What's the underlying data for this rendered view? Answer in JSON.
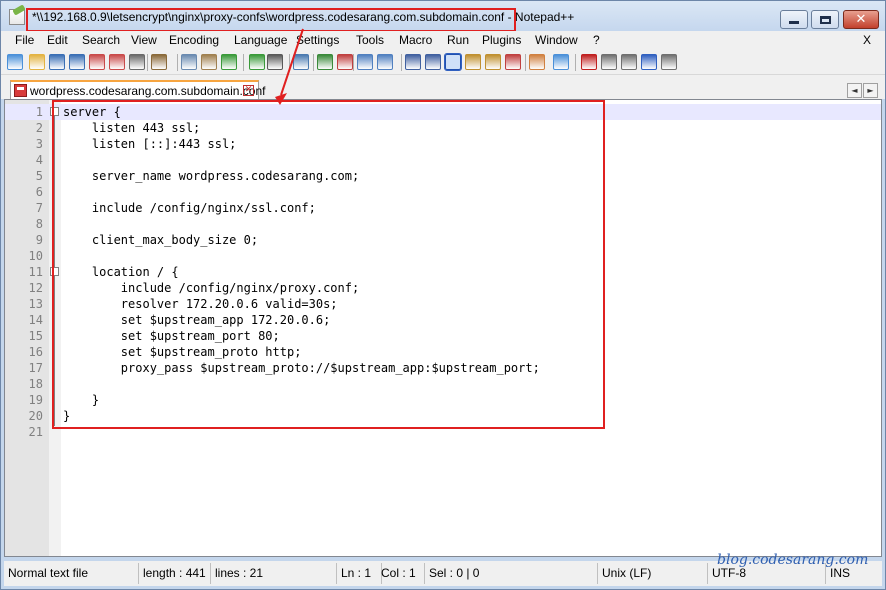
{
  "window": {
    "title": "*\\\\192.168.0.9\\letsencrypt\\nginx\\proxy-confs\\wordpress.codesarang.com.subdomain.conf - Notepad++",
    "minimize_label": "",
    "close_glyph": "✕"
  },
  "menu": {
    "items": [
      "File",
      "Edit",
      "Search",
      "View",
      "Encoding",
      "Language",
      "Settings",
      "Tools",
      "Macro",
      "Run",
      "Plugins",
      "Window",
      "?"
    ],
    "close_label": "X"
  },
  "toolbar": {
    "icons": [
      "new-file-icon",
      "open-file-icon",
      "save-icon",
      "save-all-icon",
      "close-icon",
      "close-all-icon",
      "print-icon",
      "cut-icon",
      "copy-icon",
      "paste-icon",
      "undo-icon",
      "redo-icon",
      "find-icon",
      "replace-icon",
      "zoom-in-icon",
      "zoom-out-icon",
      "sync-vertical-icon",
      "sync-horizontal-icon",
      "word-wrap-icon",
      "show-all-chars-icon",
      "indent-guide-icon",
      "user-language-icon",
      "document-map-icon",
      "function-list-icon",
      "folder-workspace-icon",
      "monitoring-icon",
      "record-macro-icon",
      "stop-record-icon",
      "play-macro-icon",
      "run-macro-multiple-icon",
      "save-macro-icon"
    ]
  },
  "tabs": {
    "active_label": "wordpress.codesarang.com.subdomain.conf",
    "close_glyph": "✕",
    "nav_left": "◄",
    "nav_right": "►"
  },
  "editor": {
    "lines": [
      "server {",
      "    listen 443 ssl;",
      "    listen [::]:443 ssl;",
      "",
      "    server_name wordpress.codesarang.com;",
      "",
      "    include /config/nginx/ssl.conf;",
      "",
      "    client_max_body_size 0;",
      "",
      "    location / {",
      "        include /config/nginx/proxy.conf;",
      "        resolver 172.20.0.6 valid=30s;",
      "        set $upstream_app 172.20.0.6;",
      "        set $upstream_port 80;",
      "        set $upstream_proto http;",
      "        proxy_pass $upstream_proto://$upstream_app:$upstream_port;",
      "",
      "    }",
      "}",
      ""
    ],
    "current_line": 1
  },
  "status": {
    "file_type": "Normal text file",
    "length": "length : 441",
    "lines": "lines : 21",
    "ln": "Ln : 1",
    "col": "Col : 1",
    "sel": "Sel : 0 | 0",
    "eol": "Unix (LF)",
    "encoding": "UTF-8",
    "mode": "INS"
  },
  "watermark": "blog.codesarang.com",
  "colors": {
    "highlight_red": "#e02020",
    "current_line_bg": "#e8e8ff",
    "tab_accent": "#f7a540"
  }
}
